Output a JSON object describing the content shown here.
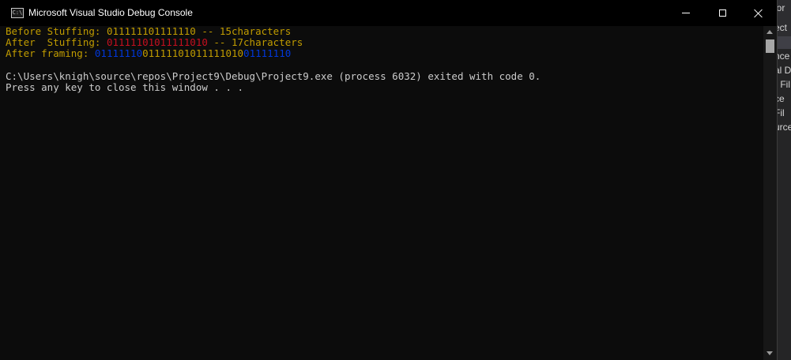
{
  "window": {
    "title": "Microsoft Visual Studio Debug Console",
    "icon_label": "C:\\"
  },
  "console": {
    "lines": [
      {
        "segments": [
          {
            "text": "Before Stuffing: ",
            "color": "yellow"
          },
          {
            "text": "011111101111110",
            "color": "yellow"
          },
          {
            "text": " -- 15characters",
            "color": "yellow"
          }
        ]
      },
      {
        "segments": [
          {
            "text": "After  Stuffing: ",
            "color": "yellow"
          },
          {
            "text": "01111101011111010",
            "color": "red"
          },
          {
            "text": " -- 17characters",
            "color": "yellow"
          }
        ]
      },
      {
        "segments": [
          {
            "text": "After framing: ",
            "color": "yellow"
          },
          {
            "text": "01111110",
            "color": "blue"
          },
          {
            "text": "01111101011111010",
            "color": "yellow"
          },
          {
            "text": "01111110",
            "color": "blue"
          }
        ]
      },
      {
        "segments": [
          {
            "text": "",
            "color": "white"
          }
        ]
      },
      {
        "segments": [
          {
            "text": "C:\\Users\\knigh\\source\\repos\\Project9\\Debug\\Project9.exe (process 6032) exited with code 0.",
            "color": "white"
          }
        ]
      },
      {
        "segments": [
          {
            "text": "Press any key to close this window . . .",
            "color": "white"
          }
        ]
      }
    ]
  },
  "background_panel": {
    "fragments": [
      "lor",
      "ect",
      "nce",
      "al D",
      "r Fil",
      "ce",
      "Fil",
      "urce"
    ]
  },
  "colors": {
    "yellow": "#c19c00",
    "red": "#c50f1f",
    "blue": "#0037da",
    "white": "#cccccc",
    "console_bg": "#0c0c0c",
    "titlebar_bg": "#000000"
  }
}
